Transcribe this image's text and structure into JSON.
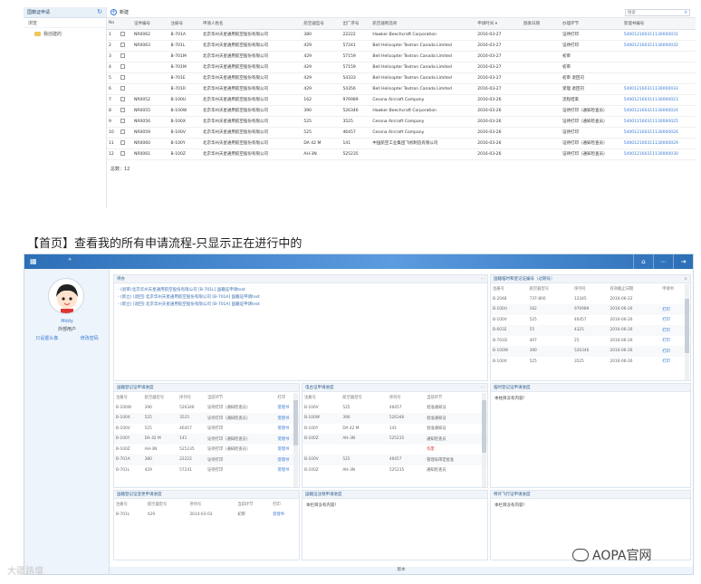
{
  "top_app": {
    "sidebar_title": "国籍证申请",
    "sidebar_sub": "浏览",
    "tree_item": "我创建的",
    "new_button": "新建",
    "search_placeholder": "搜索",
    "columns": [
      "No",
      "",
      "证件编号",
      "注册号",
      "申请人姓名",
      "航空器型号",
      "出厂序号",
      "航空器制造商",
      "申请时间 ▾",
      "颁发日期",
      "办理环节",
      "受理书编号"
    ],
    "rows": [
      [
        "1",
        "",
        "NR0062",
        "B-701A",
        "北京华州天星通用航空股份有限公司",
        "380",
        "22222",
        "Hawker Beechcraft Corporation",
        "2016-03-27",
        "",
        "证待打印",
        "540012160311130000031"
      ],
      [
        "2",
        "",
        "NR0063",
        "B-701L",
        "北京华州天星通用航空股份有限公司",
        "429",
        "57241",
        "Bell Helicopter Textron Canada Limited",
        "2016-03-27",
        "",
        "证待打印",
        "540012160311130000032"
      ],
      [
        "3",
        "",
        "",
        "B-701M",
        "北京华州天星通用航空股份有限公司",
        "429",
        "57159",
        "Bell Helicopter Textron Canada Limited",
        "2016-03-27",
        "",
        "初审",
        ""
      ],
      [
        "4",
        "",
        "",
        "B-701M",
        "北京华州天星通用航空股份有限公司",
        "429",
        "57159",
        "Bell Helicopter Textron Canada Limited",
        "2016-03-27",
        "",
        "初审",
        ""
      ],
      [
        "5",
        "",
        "",
        "B-701E",
        "北京华州天星通用航空股份有限公司",
        "429",
        "54333",
        "Bell Helicopter Textron Canada Limited",
        "2016-03-27",
        "",
        "初审 退回司",
        ""
      ],
      [
        "6",
        "",
        "",
        "B-701R",
        "北京华州天星通用航空股份有限公司",
        "429",
        "54356",
        "Bell Helicopter Textron Canada Limited",
        "2016-03-27",
        "",
        "受理 退回司",
        "540012160311130000033"
      ],
      [
        "7",
        "",
        "NR0052",
        "B-100U",
        "北京华州天星通用航空股份有限公司",
        "162",
        "976989",
        "Cessna Aircraft Company",
        "2016-03-26",
        "",
        "流程结束",
        "540012160311130000023"
      ],
      [
        "8",
        "",
        "NR0055",
        "B-100W",
        "北京华州天星通用航空股份有限公司",
        "390",
        "526346",
        "Hawker Beechcraft Corporation",
        "2016-03-26",
        "",
        "证待打印（通知检查员）",
        "540012160311130000024"
      ],
      [
        "9",
        "",
        "NR0056",
        "B-100X",
        "北京华州天星通用航空股份有限公司",
        "525",
        "3525",
        "Cessna Aircraft Company",
        "2016-03-26",
        "",
        "证待打印（通知检查员）",
        "540012160311130000025"
      ],
      [
        "10",
        "",
        "NR0059",
        "B-100V",
        "北京华州天星通用航空股份有限公司",
        "525",
        "46457",
        "Cessna Aircraft Company",
        "2016-03-26",
        "",
        "证待打印",
        "540012160311130000026"
      ],
      [
        "11",
        "",
        "NR0060",
        "B-100Y",
        "北京华州天星通用航空股份有限公司",
        "DA 42 M",
        "141",
        "中国航空工业集团飞机制造有限公司",
        "2016-03-26",
        "",
        "证待打印（通知检查员）",
        "540012160311130000029"
      ],
      [
        "12",
        "",
        "NR0061",
        "B-100Z",
        "北京华州天星通用航空股份有限公司",
        "AH-3N",
        "525235",
        "",
        "2016-03-26",
        "",
        "证待打印（通知检查员）",
        "540012160311130000030"
      ]
    ],
    "total": "总数：12"
  },
  "caption": "【首页】查看我的所有申请流程-只显示正在进行中的",
  "bottom_app": {
    "user_name": "Mddy",
    "user_role": "外部用户",
    "link_upload": "只设置头像",
    "link_password": "修改密码",
    "todo": {
      "title": "待办",
      "items": [
        "- (退审)北京华州天星通用航空股份有限公司 [B-701L] 国籍证申请test",
        "- (新立) [退回] 北京华州天星通用航空股份有限公司 [B-701A] 国籍证申请test",
        "- (新立) [退回] 北京华州天星通用航空股份有限公司 [B-701A] 国籍证申请test"
      ]
    },
    "exp_panel": {
      "title": "国籍临时和登记证编号（过期号）",
      "columns": [
        "注册号",
        "航空器型号",
        "序列号",
        "有效截止日期",
        "申请书"
      ],
      "rows": [
        [
          "B-2048",
          "737-800",
          "12345",
          "2016-06-22",
          ""
        ],
        [
          "B-100U",
          "162",
          "976989",
          "2016-06-26",
          "打印"
        ],
        [
          "B-100V",
          "525",
          "46457",
          "2016-06-26",
          "打印"
        ],
        [
          "B-601E",
          "55",
          "4325",
          "2016-06-26",
          "打印"
        ],
        [
          "B-701D",
          "407",
          "25",
          "2016-06-26",
          "打印"
        ],
        [
          "B-100W",
          "390",
          "526346",
          "2016-06-26",
          "打印"
        ],
        [
          "B-100X",
          "525",
          "3525",
          "2016-06-26",
          "打印"
        ]
      ]
    },
    "reg_panel": {
      "title": "国籍登记证申请进度",
      "columns": [
        "注册号",
        "航空器型号",
        "序列号",
        "当前环节",
        "打印"
      ],
      "rows": [
        [
          "B-100W",
          "390",
          "526346",
          "证待打印（通知检查员）",
          "受理书"
        ],
        [
          "B-100X",
          "525",
          "3525",
          "证待打印（通知检查员）",
          "受理书"
        ],
        [
          "B-100V",
          "525",
          "46457",
          "证待打印",
          "受理书"
        ],
        [
          "B-100Y",
          "DA 42 M",
          "141",
          "证待打印（通知检查员）",
          "受理书"
        ],
        [
          "B-100Z",
          "AH-3N",
          "525235",
          "证待打印（通知检查员）",
          "受理书"
        ],
        [
          "B-701A",
          "380",
          "22222",
          "证待打印",
          "受理书"
        ],
        [
          "B-701L",
          "429",
          "57241",
          "证待打印",
          "受理书"
        ]
      ]
    },
    "radio_panel": {
      "title": "电台证申请进度",
      "columns": [
        "注册号",
        "航空器型号",
        "序列号",
        "当前环节"
      ],
      "rows": [
        [
          "B-100V",
          "525",
          "46457",
          "批准通知证"
        ],
        [
          "B-100W",
          "390",
          "526346",
          "批准通知证"
        ],
        [
          "B-100Y",
          "DA 42 M",
          "141",
          "批准通知证"
        ],
        [
          "B-100Z",
          "AH-3N",
          "525235",
          "通知检查员"
        ],
        [
          "",
          "",
          "",
          "作废"
        ],
        [
          "B-100V",
          "525",
          "46457",
          "管理局审定批准"
        ],
        [
          "B-100Z",
          "AH-3N",
          "525235",
          "通知检查员"
        ]
      ]
    },
    "temp_panel": {
      "title": "临时登记证申请进度",
      "empty": "本柱目没有内容！"
    },
    "change_panel": {
      "title": "国籍登记证变更申请进度",
      "columns": [
        "注册号",
        "航空器型号",
        "序列号",
        "当前环节",
        "打印"
      ],
      "rows": [
        [
          "B-701L",
          "429",
          "2014-03-03",
          "初审",
          "受理书"
        ]
      ]
    },
    "cancel_panel": {
      "title": "国籍证注销申请进度",
      "empty": "本栏目没有内容！"
    },
    "permit_panel": {
      "title": "特许飞行证申请进度",
      "empty": "本栏目没有内容！"
    },
    "footer": "版本"
  },
  "watermarks": {
    "left": "大疆路壇",
    "right": "AOPA官网"
  },
  "colors": {
    "accent": "#3a7bd5",
    "topbar": "#2d6fb7",
    "sidebar_bg": "#eef4fb"
  }
}
